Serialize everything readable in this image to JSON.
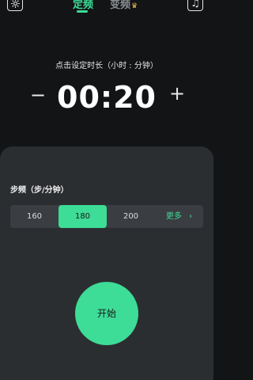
{
  "header": {
    "settings_icon": "gear-icon",
    "tabs": [
      {
        "label": "定频",
        "active": true
      },
      {
        "label": "变频",
        "active": false,
        "badge_icon": "crown-icon"
      }
    ],
    "music_icon": "music-note-icon"
  },
  "timer": {
    "prompt": "点击设定时长（小时 : 分钟）",
    "value": "00:20",
    "minus_label": "−",
    "plus_label": "+"
  },
  "cadence": {
    "title": "步频（步/分钟）",
    "options": [
      "160",
      "180",
      "200"
    ],
    "selected": "180",
    "more_label": "更多",
    "more_icon": "chevron-right-icon"
  },
  "start_button": {
    "label": "开始"
  },
  "colors": {
    "accent": "#3ddc97",
    "background": "#121416",
    "panel": "#2b2e31",
    "crown": "#f2c14e"
  }
}
